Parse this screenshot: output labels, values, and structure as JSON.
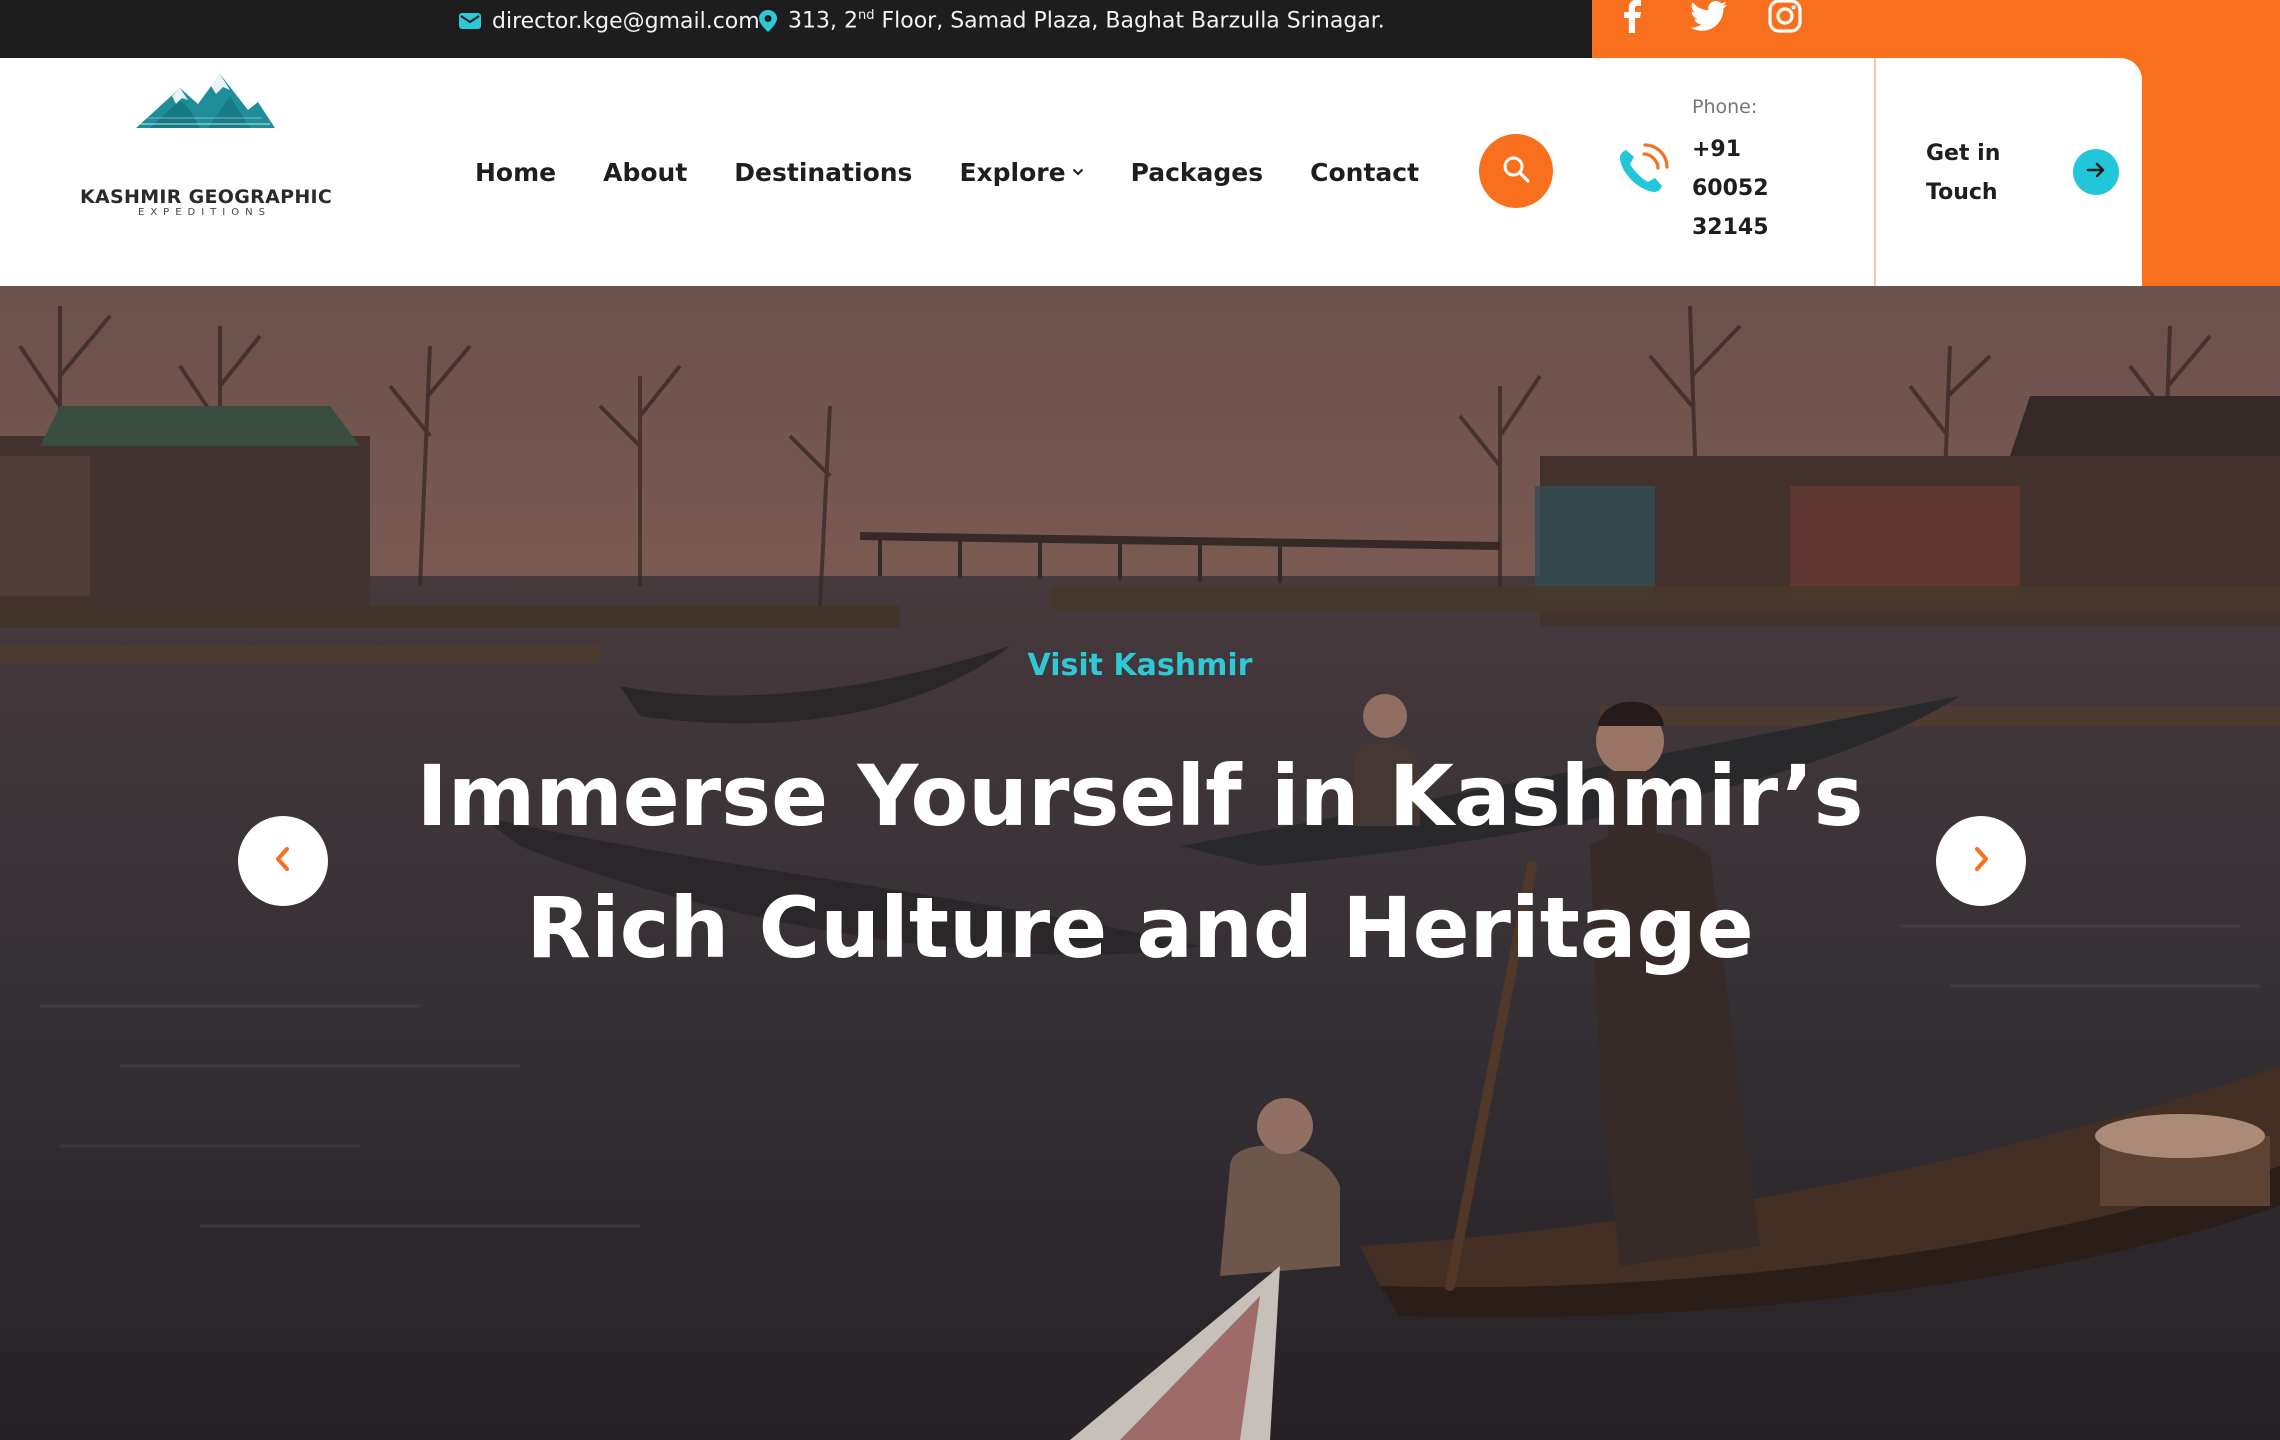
{
  "topbar": {
    "email": "director.kge@gmail.com",
    "address_pre": "313, 2",
    "address_sup": "nd",
    "address_post": " Floor, Samad Plaza, Baghat Barzulla Srinagar.",
    "social_icons": [
      "facebook-icon",
      "twitter-icon",
      "instagram-icon"
    ]
  },
  "brand": {
    "name": "KASHMIR GEOGRAPHIC",
    "tagline": "EXPEDITIONS"
  },
  "nav": {
    "items": [
      "Home",
      "About",
      "Destinations",
      "Explore",
      "Packages",
      "Contact"
    ]
  },
  "contact": {
    "phone_label": "Phone:",
    "phone_number": "+91 60052 32145",
    "cta_label": "Get in Touch"
  },
  "hero": {
    "eyebrow": "Visit Kashmir",
    "headline_line1": "Immerse Yourself in Kashmir’s",
    "headline_line2": "Rich Culture and Heritage"
  },
  "colors": {
    "accent_orange": "#f86f1e",
    "accent_teal": "#22c6d9",
    "dark": "#1d1d1d"
  }
}
